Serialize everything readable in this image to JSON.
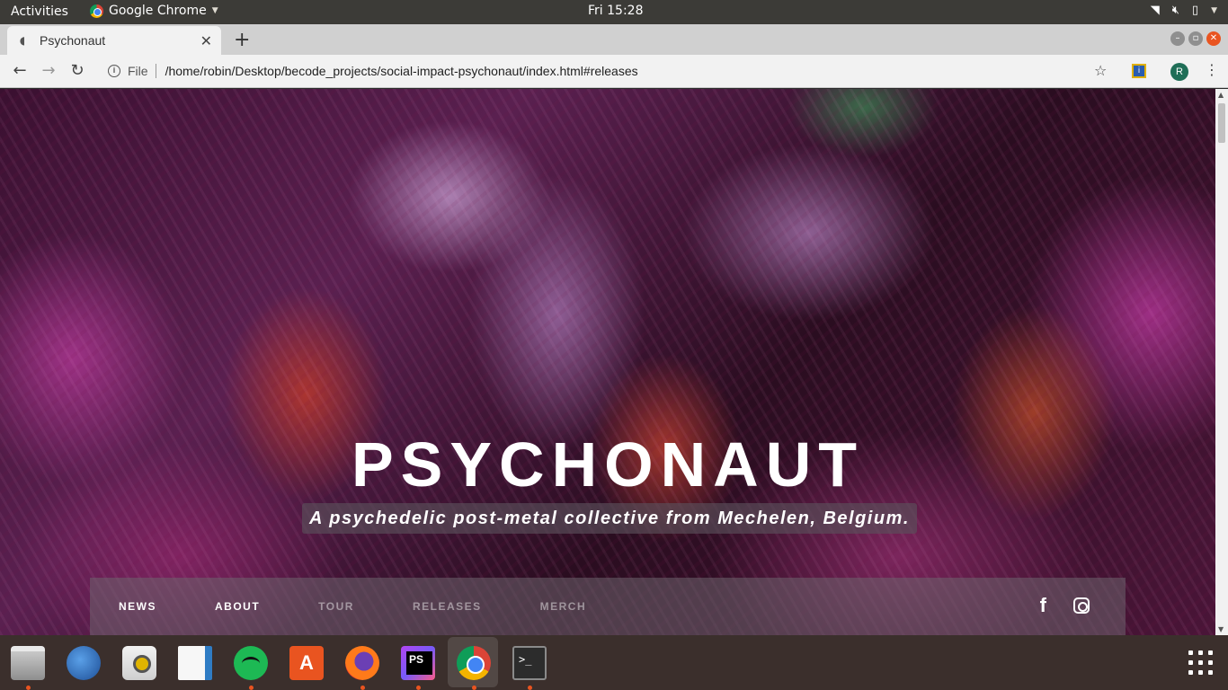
{
  "system": {
    "activities": "Activities",
    "app_name": "Google Chrome",
    "clock": "Fri 15:28"
  },
  "browser": {
    "tab_title": "Psychonaut",
    "scheme_label": "File",
    "url": "/home/robin/Desktop/becode_projects/social-impact-psychonaut/index.html#releases",
    "profile_initial": "R"
  },
  "page": {
    "band_name": "PSYCHONAUT",
    "tagline": "A psychedelic post-metal collective from Mechelen, Belgium.",
    "nav": [
      "NEWS",
      "ABOUT",
      "TOUR",
      "RELEASES",
      "MERCH"
    ],
    "social": {
      "facebook": "f"
    }
  },
  "dock": {
    "apps": [
      "files-icon",
      "thunderbird-icon",
      "rhythmbox-icon",
      "libreoffice-writer-icon",
      "spotify-icon",
      "ubuntu-software-icon",
      "firefox-icon",
      "phpstorm-icon",
      "chrome-icon",
      "terminal-icon"
    ],
    "software_letter": "A",
    "terminal_prompt": ">_"
  },
  "colors": {
    "accent": "#e95420",
    "topbar": "#3c3b37",
    "dock": "#3b2f2c"
  }
}
